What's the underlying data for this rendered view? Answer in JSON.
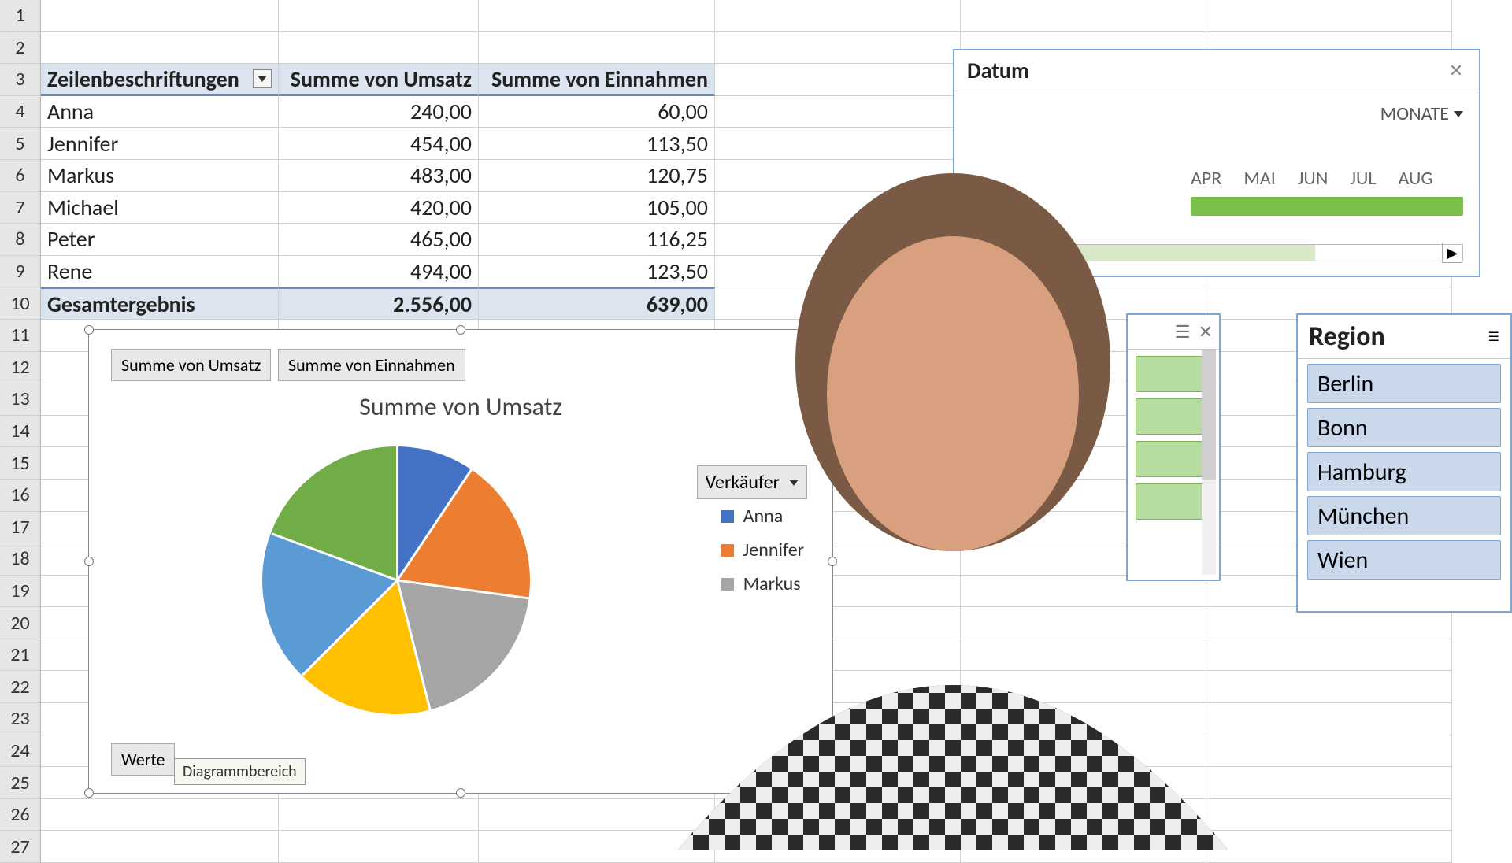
{
  "grid": {
    "row_numbers": [
      "1",
      "2",
      "3",
      "4",
      "5",
      "6",
      "7",
      "8",
      "9",
      "10",
      "11",
      "12",
      "13",
      "14",
      "15",
      "16",
      "17",
      "18",
      "19",
      "20",
      "21",
      "22",
      "23",
      "24",
      "25",
      "26",
      "27"
    ],
    "pivot": {
      "headers": {
        "c1": "Zeilenbeschriftungen",
        "c2": "Summe von Umsatz",
        "c3": "Summe von Einnahmen"
      },
      "rows": [
        {
          "name": "Anna",
          "umsatz": "240,00",
          "einnahmen": "60,00"
        },
        {
          "name": "Jennifer",
          "umsatz": "454,00",
          "einnahmen": "113,50"
        },
        {
          "name": "Markus",
          "umsatz": "483,00",
          "einnahmen": "120,75"
        },
        {
          "name": "Michael",
          "umsatz": "420,00",
          "einnahmen": "105,00"
        },
        {
          "name": "Peter",
          "umsatz": "465,00",
          "einnahmen": "116,25"
        },
        {
          "name": "Rene",
          "umsatz": "494,00",
          "einnahmen": "123,50"
        }
      ],
      "total": {
        "label": "Gesamtergebnis",
        "umsatz": "2.556,00",
        "einnahmen": "639,00"
      }
    }
  },
  "chart": {
    "field_buttons": {
      "umsatz": "Summe von Umsatz",
      "einnahmen": "Summe von Einnahmen",
      "werte": "Werte"
    },
    "title": "Summe von Umsatz",
    "tooltip": "Diagrammbereich",
    "legend_dropdown": "Verkäufer",
    "legend": [
      {
        "label": "Anna",
        "color": "#4472c4"
      },
      {
        "label": "Jennifer",
        "color": "#ed7d31"
      },
      {
        "label": "Markus",
        "color": "#a5a5a5"
      }
    ],
    "colors": {
      "anna": "#4472c4",
      "jennifer": "#ed7d31",
      "markus": "#a5a5a5",
      "michael": "#ffc000",
      "peter": "#5b9bd5",
      "rene": "#70ad47"
    }
  },
  "chart_data": {
    "type": "pie",
    "title": "Summe von Umsatz",
    "categories": [
      "Anna",
      "Jennifer",
      "Markus",
      "Michael",
      "Peter",
      "Rene"
    ],
    "values": [
      240.0,
      454.0,
      483.0,
      420.0,
      465.0,
      494.0
    ],
    "series_colors": [
      "#4472c4",
      "#ed7d31",
      "#a5a5a5",
      "#ffc000",
      "#5b9bd5",
      "#70ad47"
    ],
    "legend_position": "right"
  },
  "timeline": {
    "title": "Datum",
    "unit": "MONATE",
    "months": [
      "APR",
      "MAI",
      "JUN",
      "JUL",
      "AUG"
    ]
  },
  "slicer_region": {
    "title": "Region",
    "items": [
      "Berlin",
      "Bonn",
      "Hamburg",
      "München",
      "Wien"
    ]
  }
}
